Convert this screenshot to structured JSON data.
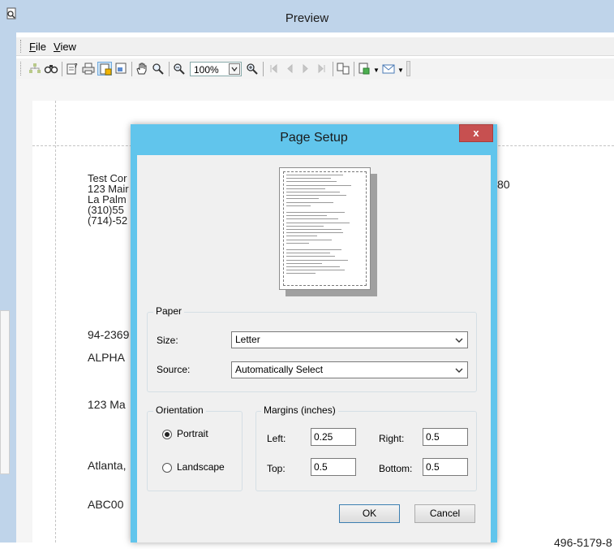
{
  "window": {
    "title": "Preview",
    "icon": "preview-app-icon"
  },
  "menu": [
    {
      "label": "File",
      "accel": "F",
      "rest": "ile"
    },
    {
      "label": "View",
      "accel": "V",
      "rest": "iew"
    }
  ],
  "toolbar": {
    "zoom_value": "100%",
    "icons": [
      "document-map-icon",
      "find-icon",
      "page-setup-icon",
      "print-icon",
      "print-layout-icon",
      "export-icon",
      "hand-tool-icon",
      "magnifier-icon",
      "zoom-out-icon",
      "zoom-in-icon",
      "first-page-icon",
      "previous-page-icon",
      "next-page-icon",
      "last-page-icon",
      "multiple-pages-icon",
      "save-icon",
      "email-icon"
    ]
  },
  "document": {
    "company_lines": [
      "Test Cor",
      "123 Mair",
      "La Palm",
      "(310)55",
      "(714)-52"
    ],
    "right_text": "80",
    "field1": "94-2369",
    "field2": "ALPHA",
    "field3": "123 Ma",
    "field4": "Atlanta,",
    "field5": "ABC00",
    "bottom_right": "496-5179-8"
  },
  "dialog": {
    "title": "Page Setup",
    "close_label": "x",
    "paper": {
      "legend": "Paper",
      "size_label": "Size:",
      "size_value": "Letter",
      "source_label": "Source:",
      "source_value": "Automatically Select"
    },
    "orientation": {
      "legend": "Orientation",
      "portrait_label": "Portrait",
      "landscape_label": "Landscape",
      "selected": "Portrait"
    },
    "margins": {
      "legend": "Margins (inches)",
      "left_label": "Left:",
      "left_value": "0.25",
      "right_label": "Right:",
      "right_value": "0.5",
      "top_label": "Top:",
      "top_value": "0.5",
      "bottom_label": "Bottom:",
      "bottom_value": "0.5"
    },
    "ok_label": "OK",
    "cancel_label": "Cancel"
  }
}
